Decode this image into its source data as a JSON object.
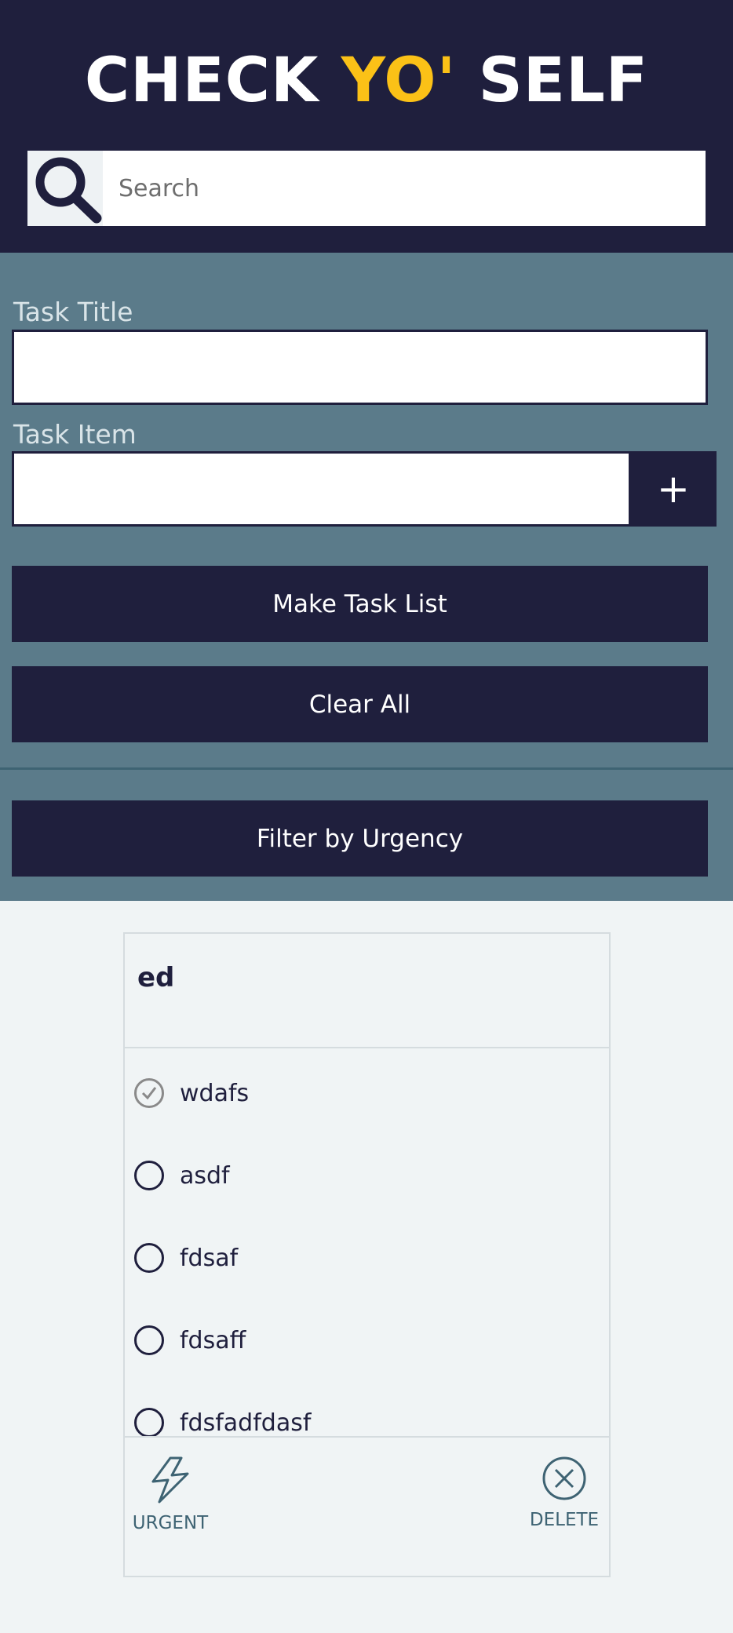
{
  "header": {
    "title_part1": "CHECK ",
    "title_part2": "YO'",
    "title_part3": " SELF",
    "search_placeholder": "Search"
  },
  "form": {
    "task_title_label": "Task Title",
    "task_item_label": "Task Item",
    "add_item_label": "+",
    "make_task_list_label": "Make Task List",
    "clear_all_label": "Clear All",
    "filter_label": "Filter by Urgency"
  },
  "card": {
    "title": "ed",
    "items": [
      {
        "text": "wdafs",
        "checked": true
      },
      {
        "text": "asdf",
        "checked": false
      },
      {
        "text": "fdsaf",
        "checked": false
      },
      {
        "text": "fdsaff",
        "checked": false
      },
      {
        "text": "fdsfadfdasf",
        "checked": false
      }
    ],
    "urgent_label": "URGENT",
    "delete_label": "DELETE"
  },
  "colors": {
    "navy": "#1f1f3d",
    "accent_yellow": "#fbc117",
    "panel_teal": "#5b7b8a",
    "icon_teal": "#3e6373"
  }
}
